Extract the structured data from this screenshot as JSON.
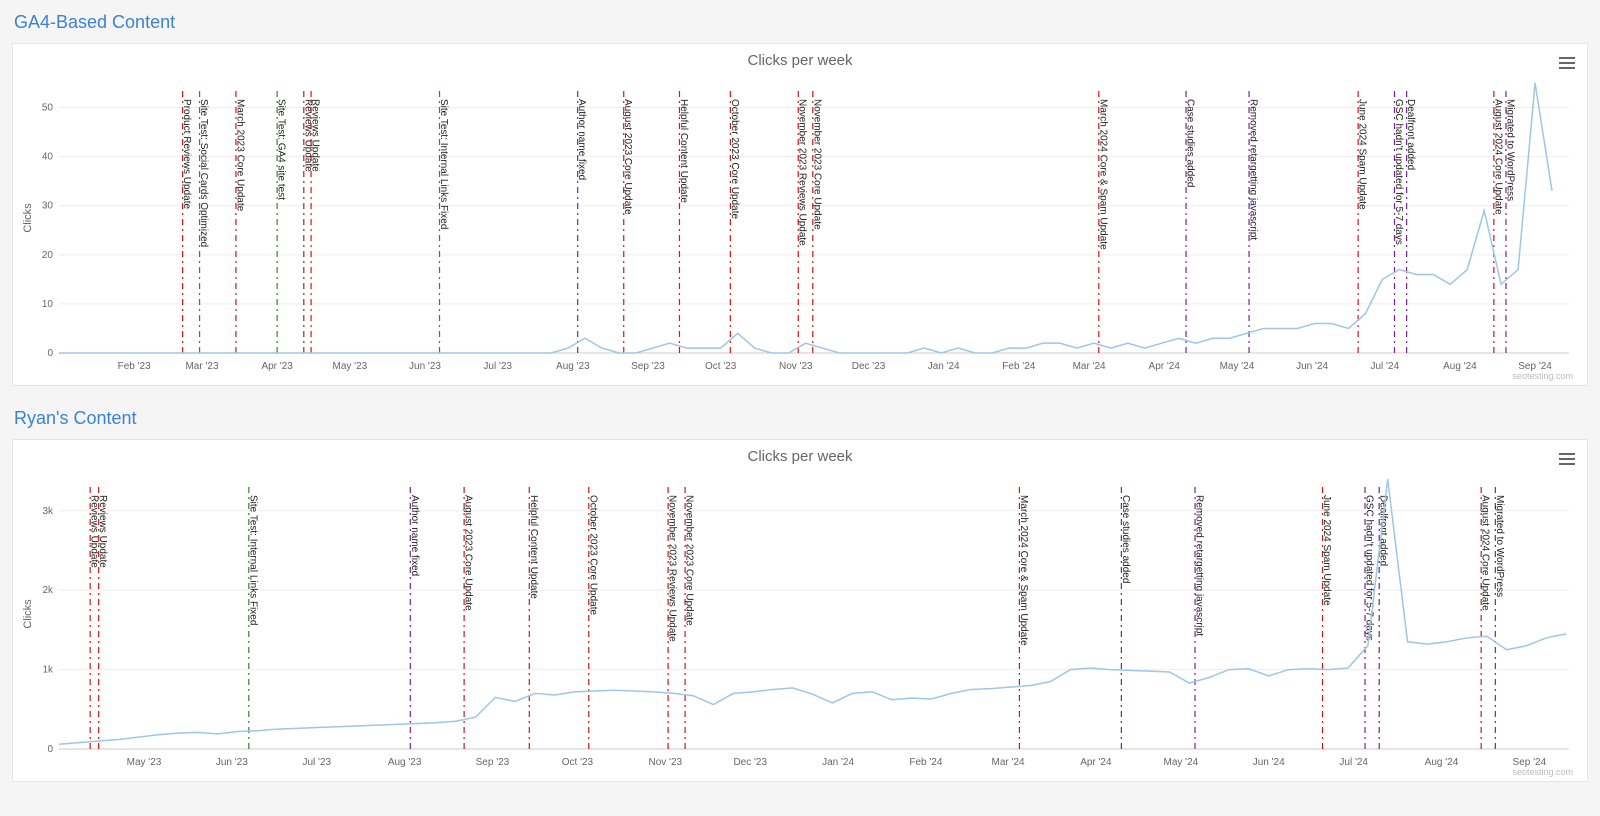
{
  "sections": [
    {
      "id": "ga4",
      "title": "GA4-Based Content"
    },
    {
      "id": "ryan",
      "title": "Ryan's Content"
    }
  ],
  "credit": "seotesting.com",
  "annotation_colors": {
    "update": "#d11",
    "test": "#2a8a2a",
    "event": "#7a1fa2"
  },
  "chart_data": [
    {
      "id": "ga4",
      "type": "line",
      "title": "Clicks per week",
      "xlabel": "",
      "ylabel": "Clicks",
      "ylim": [
        0,
        55
      ],
      "yticks": [
        0,
        10,
        20,
        30,
        40,
        50
      ],
      "x_start": "2023-01-01",
      "x_end": "2024-09-15",
      "xticks": [
        "Feb '23",
        "Mar '23",
        "Apr '23",
        "May '23",
        "Jun '23",
        "Jul '23",
        "Aug '23",
        "Sep '23",
        "Oct '23",
        "Nov '23",
        "Dec '23",
        "Jan '24",
        "Feb '24",
        "Mar '24",
        "Apr '24",
        "May '24",
        "Jun '24",
        "Jul '24",
        "Aug '24",
        "Sep '24"
      ],
      "series": [
        {
          "name": "Clicks",
          "x": [
            "2023-01-01",
            "2023-01-08",
            "2023-01-15",
            "2023-01-22",
            "2023-01-29",
            "2023-02-05",
            "2023-02-12",
            "2023-02-19",
            "2023-02-26",
            "2023-03-05",
            "2023-03-12",
            "2023-03-19",
            "2023-03-26",
            "2023-04-02",
            "2023-04-09",
            "2023-04-16",
            "2023-04-23",
            "2023-04-30",
            "2023-05-07",
            "2023-05-14",
            "2023-05-21",
            "2023-05-28",
            "2023-06-04",
            "2023-06-11",
            "2023-06-18",
            "2023-06-25",
            "2023-07-02",
            "2023-07-09",
            "2023-07-16",
            "2023-07-23",
            "2023-07-30",
            "2023-08-06",
            "2023-08-13",
            "2023-08-20",
            "2023-08-27",
            "2023-09-03",
            "2023-09-10",
            "2023-09-17",
            "2023-09-24",
            "2023-10-01",
            "2023-10-08",
            "2023-10-15",
            "2023-10-22",
            "2023-10-29",
            "2023-11-05",
            "2023-11-12",
            "2023-11-19",
            "2023-11-26",
            "2023-12-03",
            "2023-12-10",
            "2023-12-17",
            "2023-12-24",
            "2023-12-31",
            "2024-01-07",
            "2024-01-14",
            "2024-01-21",
            "2024-01-28",
            "2024-02-04",
            "2024-02-11",
            "2024-02-18",
            "2024-02-25",
            "2024-03-03",
            "2024-03-10",
            "2024-03-17",
            "2024-03-24",
            "2024-03-31",
            "2024-04-07",
            "2024-04-14",
            "2024-04-21",
            "2024-04-28",
            "2024-05-05",
            "2024-05-12",
            "2024-05-19",
            "2024-05-26",
            "2024-06-02",
            "2024-06-09",
            "2024-06-16",
            "2024-06-23",
            "2024-06-30",
            "2024-07-07",
            "2024-07-14",
            "2024-07-21",
            "2024-07-28",
            "2024-08-04",
            "2024-08-11",
            "2024-08-18",
            "2024-08-25",
            "2024-09-01",
            "2024-09-08"
          ],
          "values": [
            0,
            0,
            0,
            0,
            0,
            0,
            0,
            0,
            0,
            0,
            0,
            0,
            0,
            0,
            0,
            0,
            0,
            0,
            0,
            0,
            0,
            0,
            0,
            0,
            0,
            0,
            0,
            0,
            0,
            0,
            1,
            3,
            1,
            0,
            0,
            1,
            2,
            1,
            1,
            1,
            4,
            1,
            0,
            0,
            2,
            1,
            0,
            0,
            0,
            0,
            0,
            1,
            0,
            1,
            0,
            0,
            1,
            1,
            2,
            2,
            1,
            2,
            1,
            2,
            1,
            2,
            3,
            2,
            3,
            3,
            4,
            5,
            5,
            5,
            6,
            6,
            5,
            8,
            15,
            17,
            16,
            16,
            14,
            17,
            29,
            14,
            17,
            55,
            33
          ]
        }
      ],
      "annotations": [
        {
          "x": "2023-02-21",
          "label": "Product Reviews Update",
          "type": "update"
        },
        {
          "x": "2023-02-28",
          "label": "Site Test: Social Cards Optimized",
          "type": "test"
        },
        {
          "x": "2023-03-15",
          "label": "March 2023 Core Update",
          "type": "update"
        },
        {
          "x": "2023-04-01",
          "label": "Site Test: GA4 site test",
          "type": "test"
        },
        {
          "x": "2023-04-12",
          "label": "Reviews Update",
          "type": "update"
        },
        {
          "x": "2023-04-15",
          "label": "Reviews Update",
          "type": "update"
        },
        {
          "x": "2023-06-07",
          "label": "Site Test: Internal Links Fixed",
          "type": "test"
        },
        {
          "x": "2023-08-03",
          "label": "Author name fixed",
          "type": "event"
        },
        {
          "x": "2023-08-22",
          "label": "August 2023 Core Update",
          "type": "update"
        },
        {
          "x": "2023-09-14",
          "label": "Helpful Content Update",
          "type": "update"
        },
        {
          "x": "2023-10-05",
          "label": "October 2023 Core Update",
          "type": "update"
        },
        {
          "x": "2023-11-02",
          "label": "November 2023 Reviews Update",
          "type": "update"
        },
        {
          "x": "2023-11-08",
          "label": "November 2023 Core Update",
          "type": "update"
        },
        {
          "x": "2024-03-05",
          "label": "March 2024 Core & Spam Update",
          "type": "update"
        },
        {
          "x": "2024-04-10",
          "label": "Case studies added",
          "type": "event"
        },
        {
          "x": "2024-05-06",
          "label": "Removed retargetting javascript",
          "type": "event"
        },
        {
          "x": "2024-06-20",
          "label": "June 2024 Spam Update",
          "type": "update"
        },
        {
          "x": "2024-07-05",
          "label": "GSC hadn't updated for 5-7 days",
          "type": "event"
        },
        {
          "x": "2024-07-10",
          "label": "Dealfront added",
          "type": "event"
        },
        {
          "x": "2024-08-15",
          "label": "August 2024 Core Update",
          "type": "update"
        },
        {
          "x": "2024-08-20",
          "label": "Migrated to WordPress",
          "type": "event"
        }
      ]
    },
    {
      "id": "ryan",
      "type": "line",
      "title": "Clicks per week",
      "xlabel": "",
      "ylabel": "Clicks",
      "ylim": [
        0,
        3400
      ],
      "yticks": [
        0,
        1000,
        2000,
        3000
      ],
      "ytick_labels": [
        "0",
        "1k",
        "2k",
        "3k"
      ],
      "x_start": "2023-04-01",
      "x_end": "2024-09-15",
      "xticks": [
        "May '23",
        "Jun '23",
        "Jul '23",
        "Aug '23",
        "Sep '23",
        "Oct '23",
        "Nov '23",
        "Dec '23",
        "Jan '24",
        "Feb '24",
        "Mar '24",
        "Apr '24",
        "May '24",
        "Jun '24",
        "Jul '24",
        "Aug '24",
        "Sep '24"
      ],
      "series": [
        {
          "name": "Clicks",
          "x": [
            "2023-04-01",
            "2023-04-08",
            "2023-04-15",
            "2023-04-22",
            "2023-04-29",
            "2023-05-06",
            "2023-05-13",
            "2023-05-20",
            "2023-05-27",
            "2023-06-03",
            "2023-06-10",
            "2023-06-17",
            "2023-06-24",
            "2023-07-01",
            "2023-07-08",
            "2023-07-15",
            "2023-07-22",
            "2023-07-29",
            "2023-08-05",
            "2023-08-12",
            "2023-08-19",
            "2023-08-26",
            "2023-09-02",
            "2023-09-09",
            "2023-09-16",
            "2023-09-23",
            "2023-09-30",
            "2023-10-07",
            "2023-10-14",
            "2023-10-21",
            "2023-10-28",
            "2023-11-04",
            "2023-11-11",
            "2023-11-18",
            "2023-11-25",
            "2023-12-02",
            "2023-12-09",
            "2023-12-16",
            "2023-12-23",
            "2023-12-30",
            "2024-01-06",
            "2024-01-13",
            "2024-01-20",
            "2024-01-27",
            "2024-02-03",
            "2024-02-10",
            "2024-02-17",
            "2024-02-24",
            "2024-03-02",
            "2024-03-09",
            "2024-03-16",
            "2024-03-23",
            "2024-03-30",
            "2024-04-06",
            "2024-04-13",
            "2024-04-20",
            "2024-04-27",
            "2024-05-04",
            "2024-05-11",
            "2024-05-18",
            "2024-05-25",
            "2024-06-01",
            "2024-06-08",
            "2024-06-15",
            "2024-06-22",
            "2024-06-29",
            "2024-07-06",
            "2024-07-13",
            "2024-07-20",
            "2024-07-27",
            "2024-08-03",
            "2024-08-10",
            "2024-08-17",
            "2024-08-24",
            "2024-08-31",
            "2024-09-07",
            "2024-09-14"
          ],
          "values": [
            60,
            80,
            100,
            120,
            150,
            180,
            200,
            210,
            190,
            220,
            230,
            250,
            260,
            270,
            280,
            290,
            300,
            310,
            320,
            330,
            350,
            400,
            650,
            600,
            700,
            680,
            720,
            730,
            740,
            730,
            720,
            700,
            670,
            560,
            700,
            720,
            750,
            770,
            690,
            580,
            700,
            720,
            620,
            640,
            630,
            700,
            750,
            760,
            780,
            800,
            850,
            1000,
            1020,
            1000,
            990,
            980,
            970,
            830,
            900,
            1000,
            1010,
            920,
            1000,
            1010,
            1000,
            1020,
            1300,
            3400,
            1350,
            1320,
            1350,
            1400,
            1420,
            1250,
            1300,
            1400,
            1450
          ]
        }
      ],
      "annotations": [
        {
          "x": "2023-04-12",
          "label": "Reviews Update",
          "type": "update"
        },
        {
          "x": "2023-04-15",
          "label": "Reviews Update",
          "type": "update"
        },
        {
          "x": "2023-06-07",
          "label": "Site Test: Internal Links Fixed",
          "type": "test"
        },
        {
          "x": "2023-08-03",
          "label": "Author name fixed",
          "type": "event"
        },
        {
          "x": "2023-08-22",
          "label": "August 2023 Core Update",
          "type": "update"
        },
        {
          "x": "2023-09-14",
          "label": "Helpful Content Update",
          "type": "update"
        },
        {
          "x": "2023-10-05",
          "label": "October 2023 Core Update",
          "type": "update"
        },
        {
          "x": "2023-11-02",
          "label": "November 2023 Reviews Update",
          "type": "update"
        },
        {
          "x": "2023-11-08",
          "label": "November 2023 Core Update",
          "type": "update"
        },
        {
          "x": "2024-03-05",
          "label": "March 2024 Core & Spam Update",
          "type": "update"
        },
        {
          "x": "2024-04-10",
          "label": "Case studies added",
          "type": "event"
        },
        {
          "x": "2024-05-06",
          "label": "Removed retargetting javascript",
          "type": "event"
        },
        {
          "x": "2024-06-20",
          "label": "June 2024 Spam Update",
          "type": "update"
        },
        {
          "x": "2024-07-05",
          "label": "GSC hadn't updated for 5-7 days",
          "type": "event"
        },
        {
          "x": "2024-07-10",
          "label": "Dealfront added",
          "type": "event"
        },
        {
          "x": "2024-08-15",
          "label": "August 2024 Core Update",
          "type": "update"
        },
        {
          "x": "2024-08-20",
          "label": "Migrated to WordPress",
          "type": "event"
        }
      ]
    }
  ]
}
